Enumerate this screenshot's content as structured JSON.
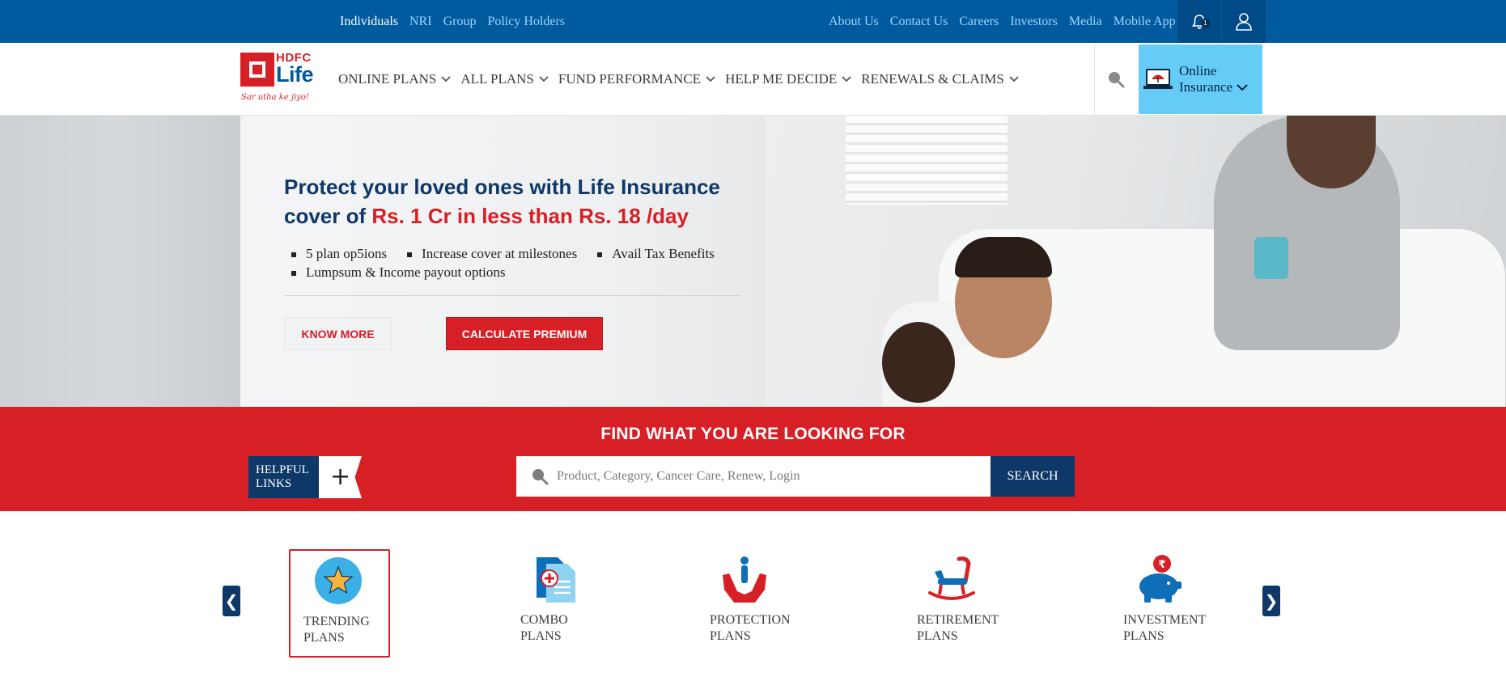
{
  "topbar": {
    "left_links": [
      "Individuals",
      "NRI",
      "Group",
      "Policy Holders"
    ],
    "right_links": [
      "About Us",
      "Contact Us",
      "Careers",
      "Investors",
      "Media",
      "Mobile App"
    ],
    "notification_count": "1"
  },
  "logo": {
    "brand_top": "HDFC",
    "brand_bottom": "Life",
    "tagline": "Sar utha ke jiyo!"
  },
  "nav": {
    "menu": [
      "ONLINE PLANS",
      "ALL PLANS",
      "FUND PERFORMANCE",
      "HELP ME DECIDE",
      "RENEWALS & CLAIMS"
    ],
    "online_insurance": {
      "line1": "Online",
      "line2": "Insurance"
    }
  },
  "hero": {
    "title_part1": "Protect your loved ones with Life Insurance cover of ",
    "title_highlight": "Rs. 1 Cr in less than Rs. 18 /day",
    "bullets": [
      "5 plan op5ions",
      "Increase cover at milestones",
      "Avail Tax Benefits",
      "Lumpsum & Income payout options"
    ],
    "know_more": "KNOW MORE",
    "calculate_premium": "CALCULATE PREMIUM"
  },
  "finder": {
    "title": "FIND WHAT YOU ARE LOOKING FOR",
    "helpful_links": "HELPFUL LINKS",
    "plus": "+",
    "search_placeholder": "Product, Category, Cancer Care, Renew, Login",
    "search_value": "",
    "search_button": "SEARCH"
  },
  "categories": {
    "prev": "❮",
    "next": "❯",
    "items": [
      {
        "line1": "TRENDING",
        "line2": "PLANS",
        "icon": "star-icon",
        "active": true
      },
      {
        "line1": "COMBO",
        "line2": "PLANS",
        "icon": "combo-document-icon",
        "active": false
      },
      {
        "line1": "PROTECTION",
        "line2": "PLANS",
        "icon": "protection-hands-icon",
        "active": false
      },
      {
        "line1": "RETIREMENT",
        "line2": "PLANS",
        "icon": "rocking-chair-icon",
        "active": false
      },
      {
        "line1": "INVESTMENT",
        "line2": "PLANS",
        "icon": "piggy-bank-icon",
        "active": false
      }
    ]
  },
  "colors": {
    "brand_red": "#d71f26",
    "brand_blue": "#005a9e",
    "navy": "#0d3867",
    "online_insurance_bg": "#65ccf7"
  }
}
